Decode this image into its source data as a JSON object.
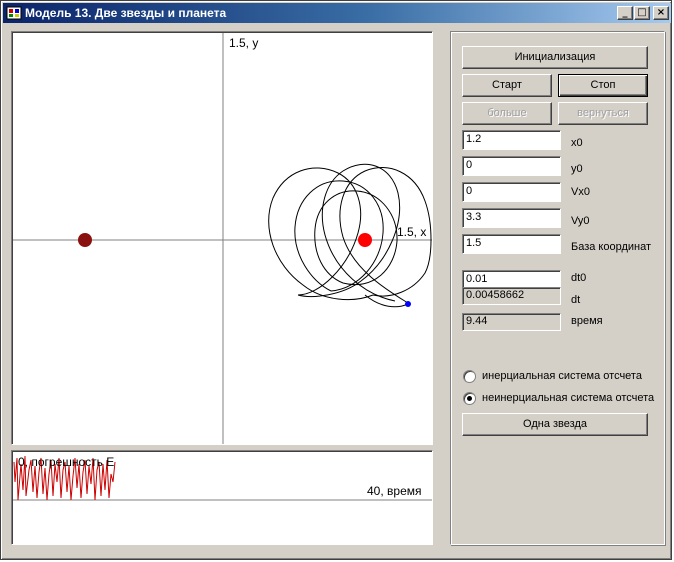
{
  "window": {
    "title": "Модель 13. Две звезды и планета",
    "minimize_glyph": "_",
    "maximize_glyph": "□",
    "close_glyph": "×"
  },
  "plot": {
    "y_axis_label": "1.5, y",
    "x_axis_label": "1.5, x"
  },
  "error_plot": {
    "y_label": "0, погрешность E",
    "x_label": "40, время"
  },
  "buttons": {
    "init": "Инициализация",
    "start": "Старт",
    "stop": "Стоп",
    "more": "больше",
    "back": "вернуться",
    "one_star": "Одна звезда"
  },
  "fields": [
    {
      "label": "x0",
      "value": "1.2"
    },
    {
      "label": "y0",
      "value": "0"
    },
    {
      "label": "Vx0",
      "value": "0"
    },
    {
      "label": "Vy0",
      "value": "3.3"
    },
    {
      "label": "База координат",
      "value": "1.5"
    },
    {
      "label": "dt0",
      "value": "0.01"
    }
  ],
  "readouts": [
    {
      "label": "dt",
      "value": "0.00458662"
    },
    {
      "label": "время",
      "value": "9.44"
    }
  ],
  "radios": {
    "inertial": {
      "label": "инерциальная система отсчета",
      "checked": false
    },
    "noninertial": {
      "label": "неинерциальная система отсчета",
      "checked": true
    }
  },
  "colors": {
    "star_left": "#8b1010",
    "star_right": "#ff0000",
    "planet": "#0000ff",
    "error_curve": "#cc0000"
  }
}
